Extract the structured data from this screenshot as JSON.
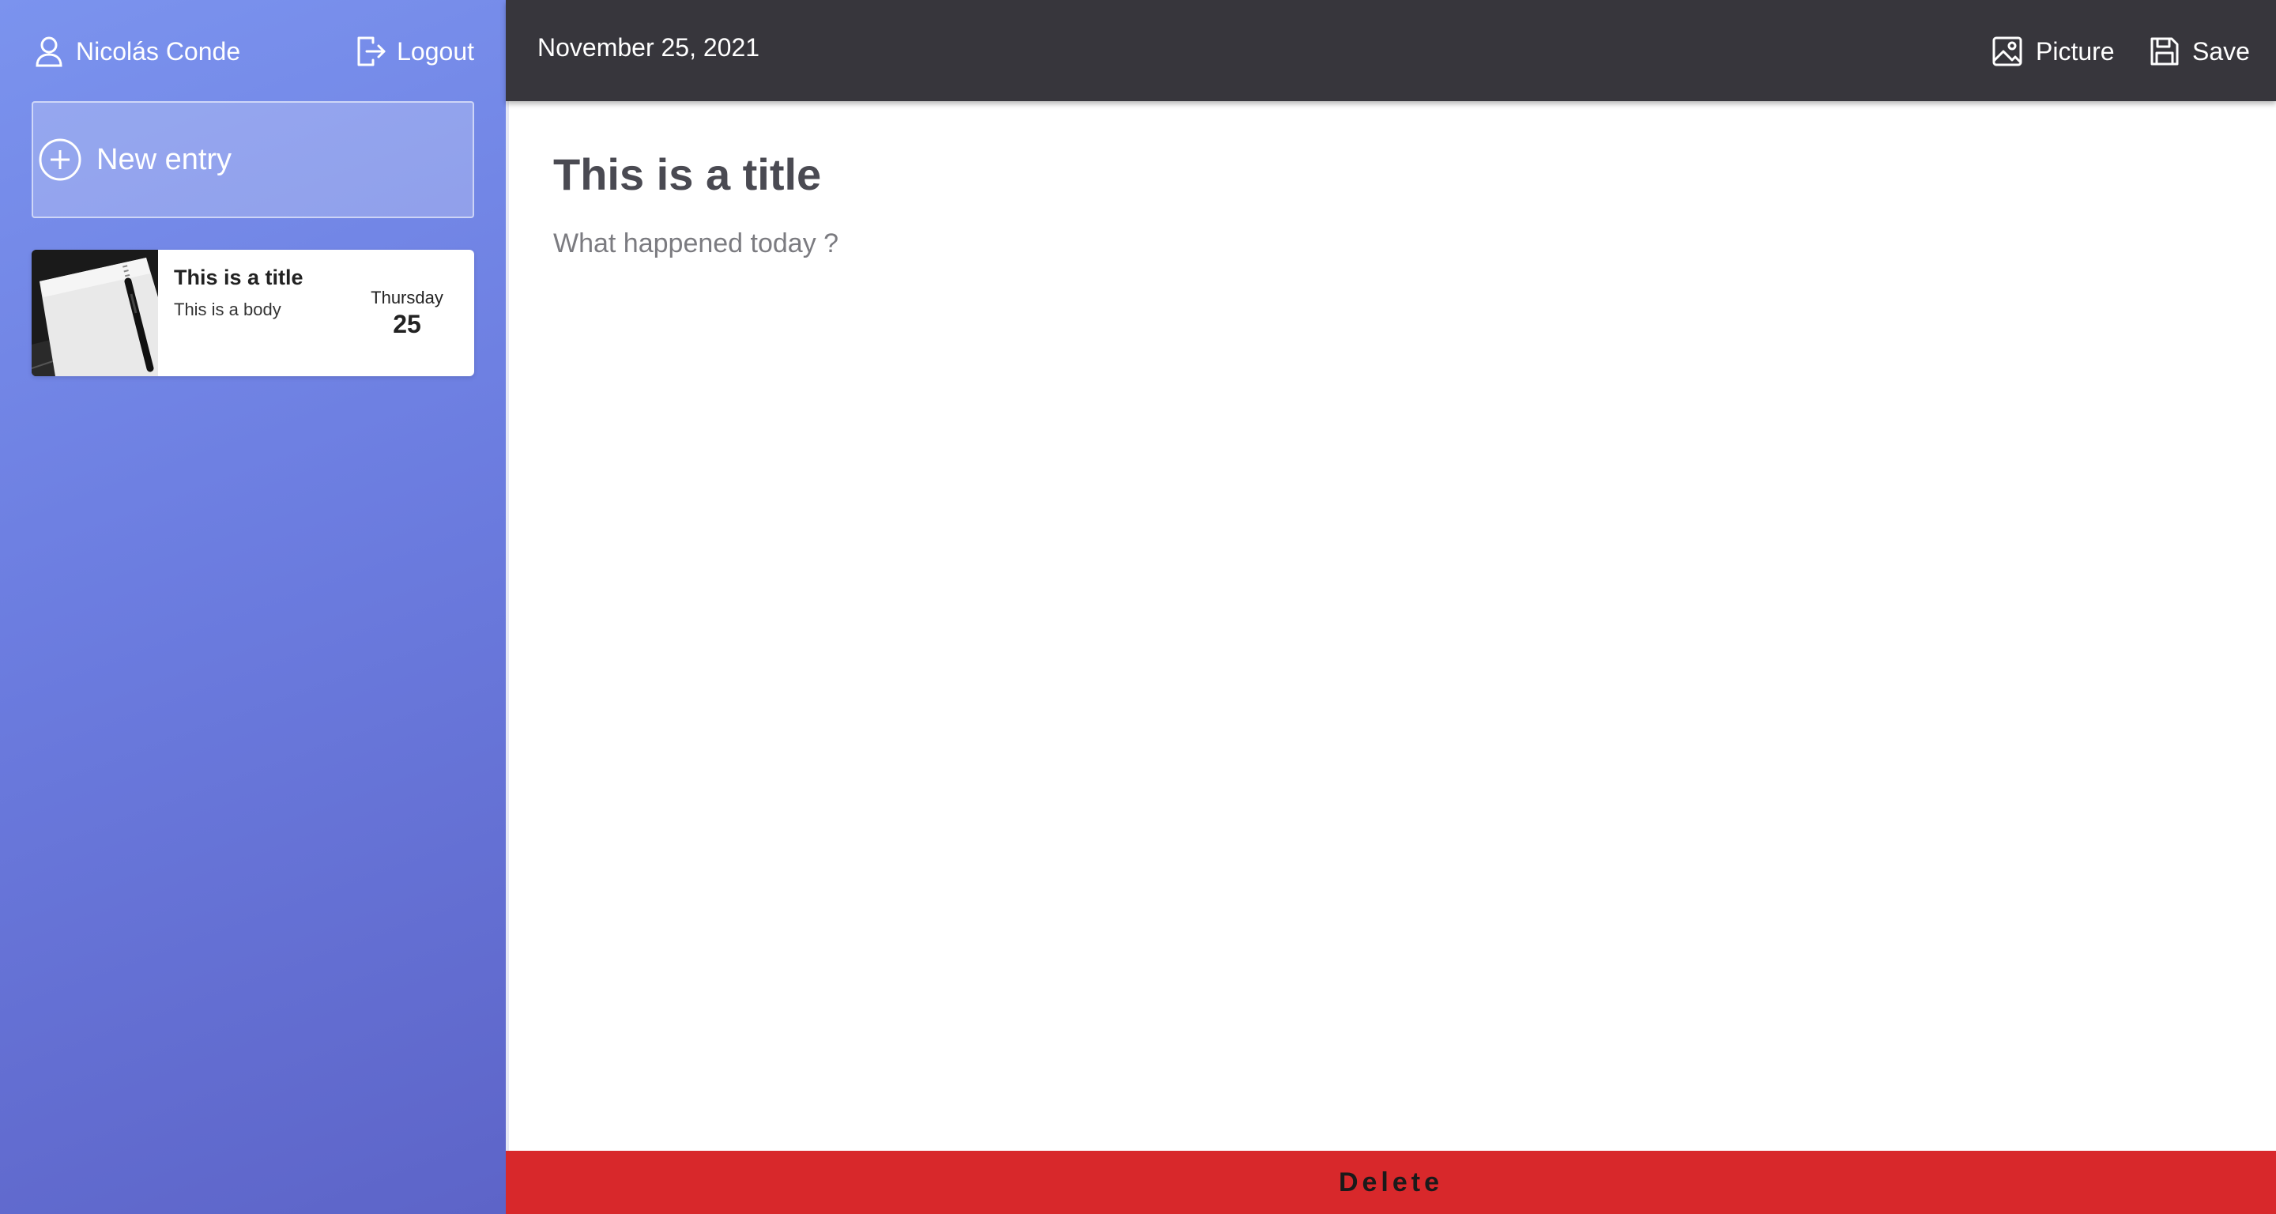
{
  "sidebar": {
    "user_name": "Nicolás Conde",
    "logout_label": "Logout",
    "new_entry_label": "New entry",
    "entries": [
      {
        "title": "This is a title",
        "body": "This is a body",
        "weekday": "Thursday",
        "day": "25",
        "thumbnail_icon": "notebook-pen-photo"
      }
    ]
  },
  "topbar": {
    "date": "November 25, 2021",
    "picture_label": "Picture",
    "save_label": "Save"
  },
  "editor": {
    "title": "This is a title",
    "body_placeholder": "What happened today ?",
    "body_value": ""
  },
  "footer": {
    "delete_label": "Delete"
  },
  "colors": {
    "sidebar_gradient_start": "#7b93ee",
    "sidebar_gradient_end": "#5d64c8",
    "topbar_bg": "#37363c",
    "delete_bg": "#d8282b"
  },
  "icons": {
    "user": "user-icon",
    "logout": "logout-icon",
    "new_entry": "plus-circle-icon",
    "picture": "image-icon",
    "save": "floppy-disk-icon"
  }
}
